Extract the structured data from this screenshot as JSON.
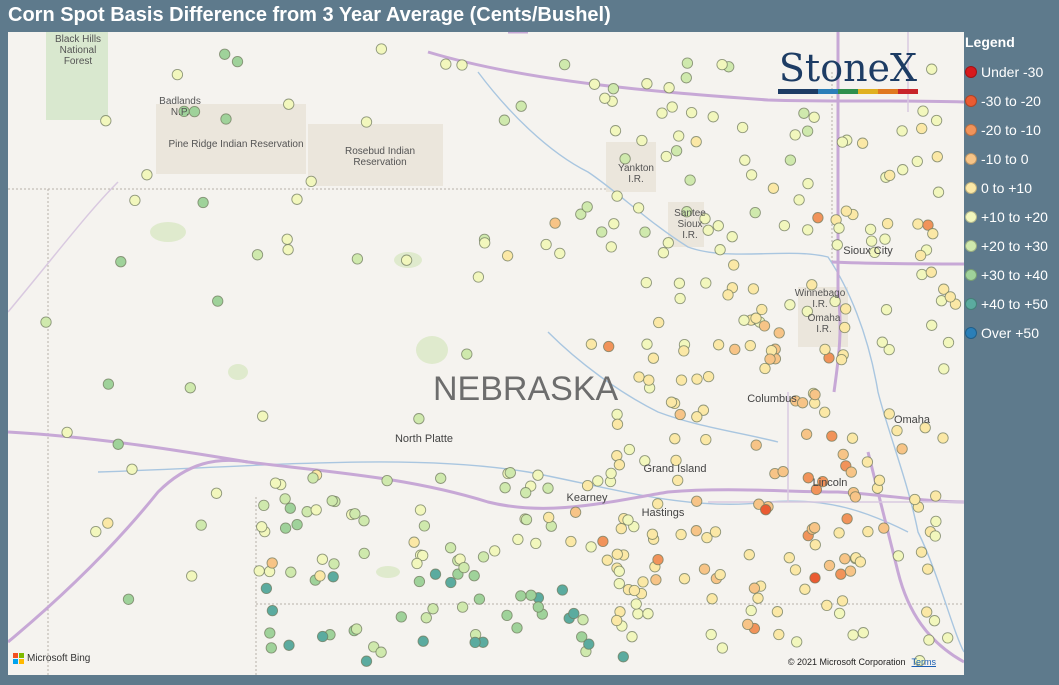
{
  "title": "Corn Spot Basis Difference from 3 Year Average (Cents/Bushel)",
  "legend": {
    "title": "Legend",
    "items": [
      {
        "label": "Under -30",
        "color": "#d7191c"
      },
      {
        "label": "-30 to -20",
        "color": "#ea5b32"
      },
      {
        "label": "-20 to -10",
        "color": "#f1935a"
      },
      {
        "label": "-10 to 0",
        "color": "#f7c487"
      },
      {
        "label": "0 to +10",
        "color": "#fbe8a6"
      },
      {
        "label": "+10 to +20",
        "color": "#f2f7bd"
      },
      {
        "label": "+20 to +30",
        "color": "#cfe9ad"
      },
      {
        "label": "+30 to +40",
        "color": "#9fd29a"
      },
      {
        "label": "+40 to +50",
        "color": "#5bab9f"
      },
      {
        "label": "Over +50",
        "color": "#2b7fb8"
      }
    ]
  },
  "logo": {
    "text": "StoneX",
    "bar_colors": [
      "#1d3c64",
      "#1d3c64",
      "#2b7fb8",
      "#2f8f4e",
      "#e0b020",
      "#e07820",
      "#c8242b"
    ]
  },
  "map": {
    "state_label": "NEBRASKA",
    "places": [
      {
        "name": "Black Hills\nNational\nForest"
      },
      {
        "name": "Badlands\nN.P."
      },
      {
        "name": "Pine Ridge Indian Reservation"
      },
      {
        "name": "Rosebud Indian\nReservation"
      },
      {
        "name": "Yankton\nI.R."
      },
      {
        "name": "Santee\nSioux\nI.R."
      },
      {
        "name": "Winnebago\nI.R."
      },
      {
        "name": "Omaha\nI.R."
      }
    ],
    "cities": [
      {
        "name": "Sioux City"
      },
      {
        "name": "Columbus"
      },
      {
        "name": "Omaha"
      },
      {
        "name": "North Platte"
      },
      {
        "name": "Grand Island"
      },
      {
        "name": "Kearney"
      },
      {
        "name": "Hastings"
      },
      {
        "name": "Lincoln"
      }
    ],
    "attribution": {
      "provider": "Microsoft Bing",
      "copyright": "© 2021 Microsoft Corporation",
      "terms": "Terms"
    }
  }
}
